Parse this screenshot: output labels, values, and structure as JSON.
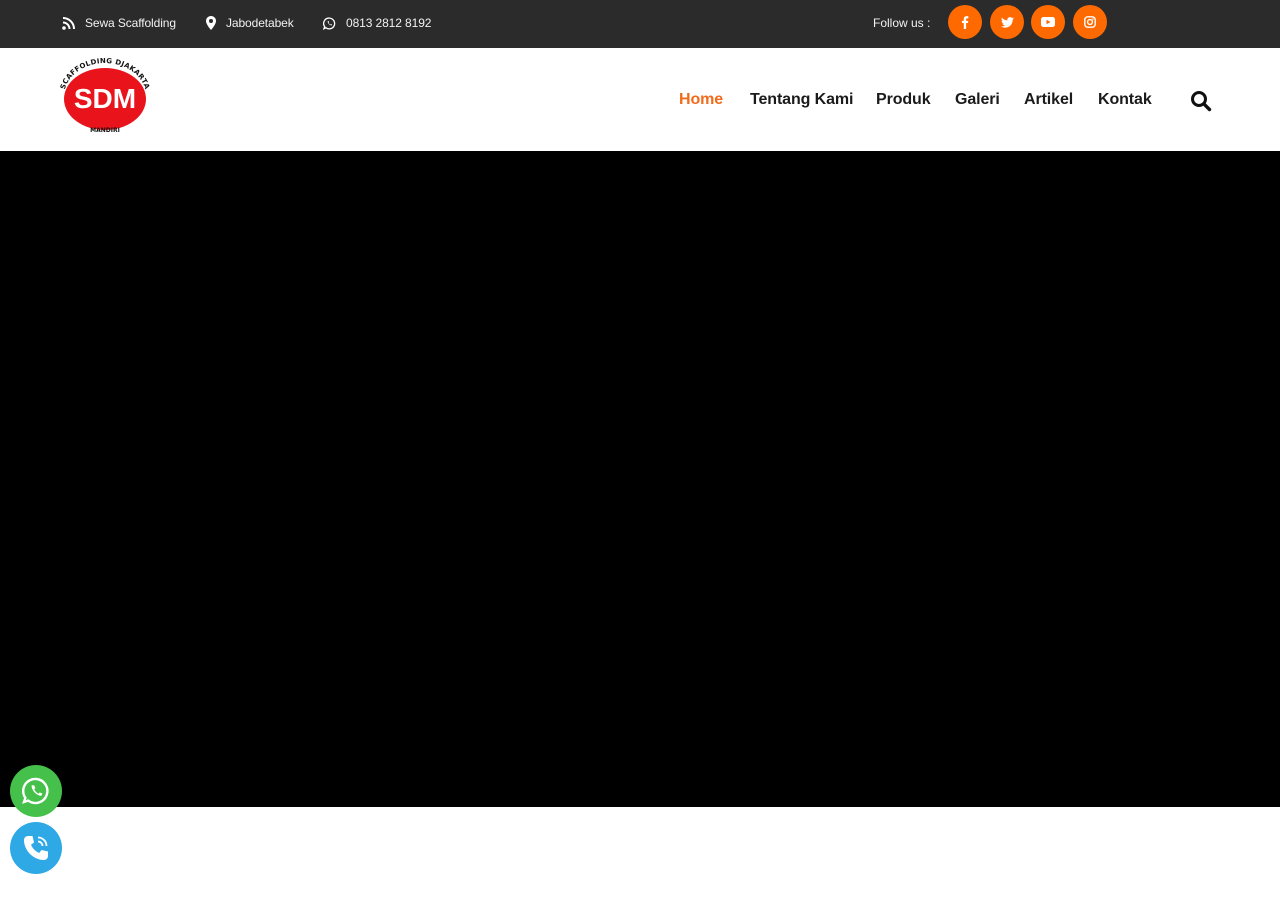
{
  "topbar": {
    "items": [
      {
        "icon": "rss-icon",
        "label": "Sewa Scaffolding"
      },
      {
        "icon": "map-marker-icon",
        "label": "Jabodetabek"
      },
      {
        "icon": "whatsapp-icon",
        "label": "0813 2812 8192"
      }
    ],
    "follow_label": "Follow us :",
    "social": [
      {
        "icon": "facebook-icon"
      },
      {
        "icon": "twitter-icon"
      },
      {
        "icon": "youtube-icon"
      },
      {
        "icon": "instagram-icon"
      }
    ],
    "accent_color": "#ff6a00"
  },
  "header": {
    "logo": {
      "main_text": "SDM",
      "top_arc_text": "SCAFFOLDING DJAKARTA",
      "bottom_text": "MANDIRI",
      "color": "#e8131b"
    },
    "nav": [
      {
        "label": "Home",
        "active": true
      },
      {
        "label": "Tentang Kami"
      },
      {
        "label": "Produk"
      },
      {
        "label": "Galeri"
      },
      {
        "label": "Artikel"
      },
      {
        "label": "Kontak"
      }
    ],
    "active_color": "#f26b1d",
    "search_icon": "search-icon"
  },
  "hero": {
    "background": "#000000"
  },
  "floating": [
    {
      "icon": "whatsapp-icon",
      "color": "#45c04a"
    },
    {
      "icon": "phone-icon",
      "color": "#2fa8e6"
    }
  ]
}
